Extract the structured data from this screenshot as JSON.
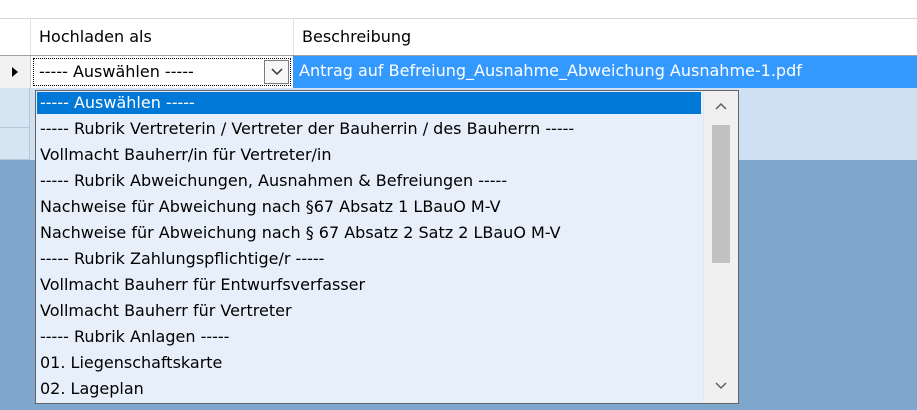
{
  "grid": {
    "columns": [
      {
        "label": "Hochladen als"
      },
      {
        "label": "Beschreibung"
      }
    ],
    "row": {
      "combo_value": "----- Auswählen -----",
      "description": "Antrag auf Befreiung_Ausnahme_Abweichung Ausnahme-1.pdf"
    }
  },
  "dropdown": {
    "options": [
      "----- Auswählen -----",
      "----- Rubrik Vertreterin / Vertreter der Bauherrin / des Bauherrn -----",
      "Vollmacht Bauherr/in für Vertreter/in",
      "----- Rubrik Abweichungen, Ausnahmen & Befreiungen -----",
      "Nachweise für Abweichung nach §67 Absatz 1 LBauO M-V",
      "Nachweise für Abweichung nach § 67 Absatz 2 Satz 2 LBauO M-V",
      "----- Rubrik Zahlungspflichtige/r -----",
      "Vollmacht Bauherr für Entwurfsverfasser",
      "Vollmacht Bauherr für Vertreter",
      "----- Rubrik Anlagen -----",
      "01. Liegenschaftskarte",
      "02. Lageplan"
    ],
    "selected_index": 0
  },
  "colors": {
    "selection": "#0078d7",
    "cell_highlight": "#3399ff",
    "list_background": "#e7f0fa",
    "grid_background": "#7fa6cd"
  },
  "icons": {
    "row_pointer": "arrow-right-icon",
    "combo_button": "chevron-down-icon",
    "scroll_up": "chevron-up-icon",
    "scroll_down": "chevron-down-icon"
  }
}
